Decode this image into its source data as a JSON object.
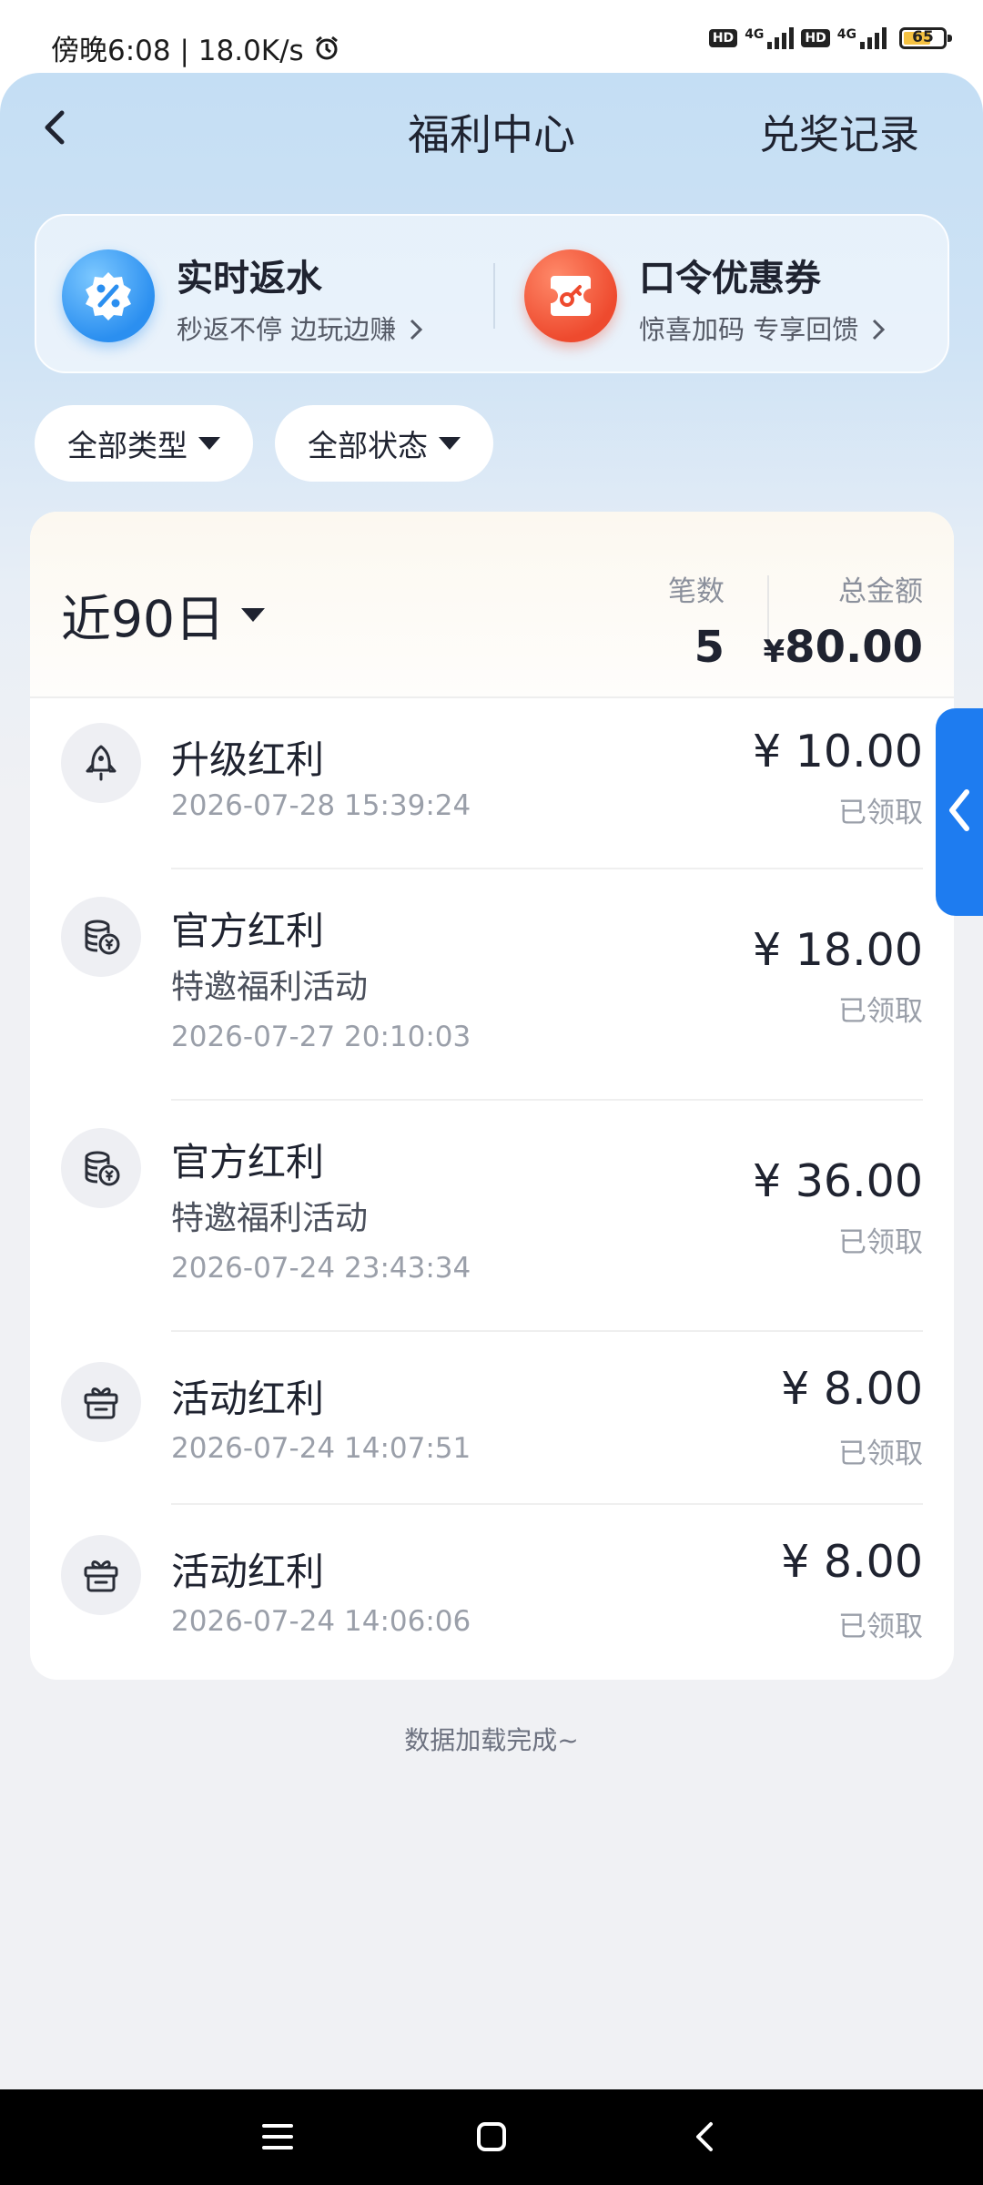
{
  "status_bar": {
    "time_text": "傍晚6:08 | 18.0K/s",
    "network_1": "4G",
    "network_2": "4G",
    "hd_label": "HD",
    "battery": "65"
  },
  "header": {
    "title": "福利中心",
    "right_action": "兑奖记录"
  },
  "promos": [
    {
      "title": "实时返水",
      "subtitle": "秒返不停 边玩边赚",
      "icon": "percent-badge-icon",
      "color": "#2b8ff0"
    },
    {
      "title": "口令优惠券",
      "subtitle": "惊喜加码 专享回馈",
      "icon": "key-coupon-icon",
      "color": "#ee4a2e"
    }
  ],
  "filters": [
    {
      "label": "全部类型"
    },
    {
      "label": "全部状态"
    }
  ],
  "summary": {
    "period": "近90日",
    "count_label": "笔数",
    "count_value": "5",
    "total_label": "总金额",
    "total_currency": "¥",
    "total_value": "80.00"
  },
  "records": [
    {
      "title": "升级红利",
      "subtitle": "",
      "time": "2026-07-28 15:39:24",
      "amount": "¥ 10.00",
      "status": "已领取",
      "icon": "rocket-icon"
    },
    {
      "title": "官方红利",
      "subtitle": "特邀福利活动",
      "time": "2026-07-27 20:10:03",
      "amount": "¥ 18.00",
      "status": "已领取",
      "icon": "coin-stack-icon"
    },
    {
      "title": "官方红利",
      "subtitle": "特邀福利活动",
      "time": "2026-07-24 23:43:34",
      "amount": "¥ 36.00",
      "status": "已领取",
      "icon": "coin-stack-icon"
    },
    {
      "title": "活动红利",
      "subtitle": "",
      "time": "2026-07-24 14:07:51",
      "amount": "¥ 8.00",
      "status": "已领取",
      "icon": "gift-icon"
    },
    {
      "title": "活动红利",
      "subtitle": "",
      "time": "2026-07-24 14:06:06",
      "amount": "¥ 8.00",
      "status": "已领取",
      "icon": "gift-icon"
    }
  ],
  "footer": {
    "text": "数据加载完成~"
  }
}
